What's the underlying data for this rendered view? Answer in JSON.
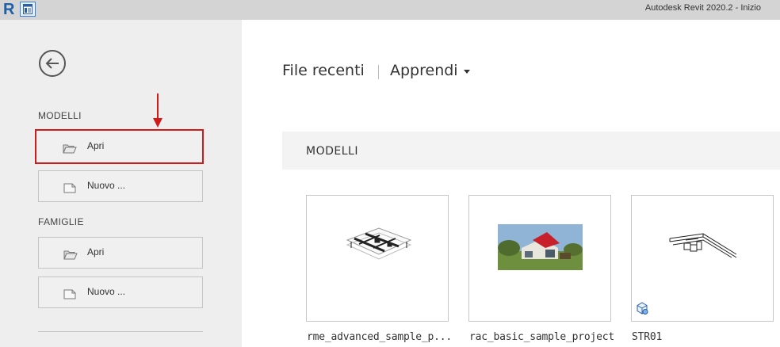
{
  "window": {
    "title": "Autodesk Revit 2020.2 - Inizio",
    "app_logo": "R"
  },
  "sidebar": {
    "back_icon": "arrow-left-circle-icon",
    "models_label": "MODELLI",
    "models_open_label": "Apri",
    "models_new_label": "Nuovo ...",
    "families_label": "FAMIGLIE",
    "families_open_label": "Apri",
    "families_new_label": "Nuovo ..."
  },
  "main": {
    "tab_recent": "File recenti",
    "tab_learn": "Apprendi",
    "section_title": "MODELLI",
    "files": [
      {
        "name": "rme_advanced_sample_p...",
        "thumbnail": "mep-model-thumbnail"
      },
      {
        "name": "rac_basic_sample_project",
        "thumbnail": "house-render-thumbnail"
      },
      {
        "name": "STR01",
        "thumbnail": "structure-model-thumbnail",
        "cloud": true
      }
    ]
  },
  "colors": {
    "highlight_red": "#d01b1b",
    "sidebar_bg": "#eeeeee",
    "titlebar_bg": "#d4d4d4",
    "brand_blue": "#1f5fa8"
  }
}
